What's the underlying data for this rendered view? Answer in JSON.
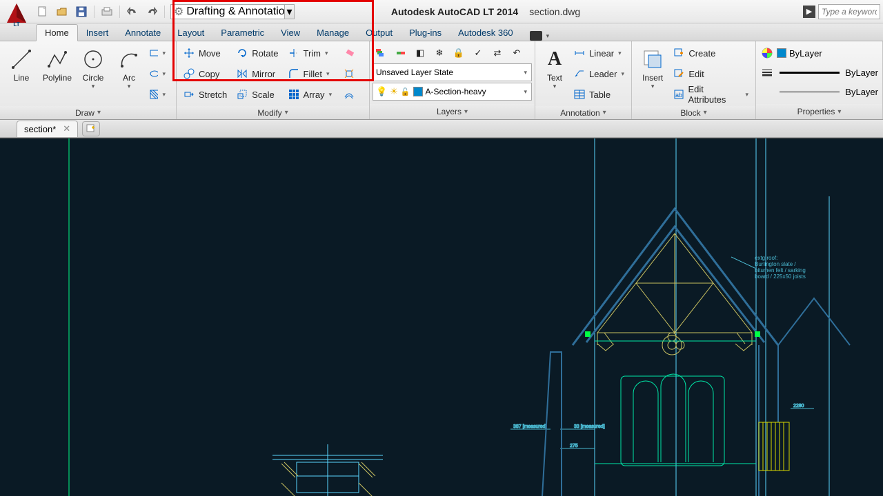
{
  "titlebar": {
    "app_name": "Autodesk AutoCAD LT 2014",
    "file_name": "section.dwg",
    "workspace": "Drafting & Annotation",
    "search_placeholder": "Type a keyword"
  },
  "tabs": {
    "items": [
      "Home",
      "Insert",
      "Annotate",
      "Layout",
      "Parametric",
      "View",
      "Manage",
      "Output",
      "Plug-ins",
      "Autodesk 360"
    ],
    "active": "Home"
  },
  "panels": {
    "draw": {
      "title": "Draw",
      "line": "Line",
      "polyline": "Polyline",
      "circle": "Circle",
      "arc": "Arc"
    },
    "modify": {
      "title": "Modify",
      "move": "Move",
      "rotate": "Rotate",
      "trim": "Trim",
      "copy": "Copy",
      "mirror": "Mirror",
      "fillet": "Fillet",
      "stretch": "Stretch",
      "scale": "Scale",
      "array": "Array"
    },
    "layers": {
      "title": "Layers",
      "state": "Unsaved Layer State",
      "current": "A-Section-heavy"
    },
    "annotation": {
      "title": "Annotation",
      "text": "Text",
      "linear": "Linear",
      "leader": "Leader",
      "table": "Table"
    },
    "block": {
      "title": "Block",
      "insert": "Insert",
      "create": "Create",
      "edit": "Edit",
      "edit_attr": "Edit Attributes"
    },
    "properties": {
      "title": "Properties",
      "bylayer1": "ByLayer",
      "bylayer2": "ByLayer",
      "bylayer3": "ByLayer"
    }
  },
  "doc_tabs": {
    "active": "section*"
  },
  "drawing_annotations": {
    "note": "extg roof: Burlington slate / bitumen felt / sarking board / 225x50 joists"
  }
}
